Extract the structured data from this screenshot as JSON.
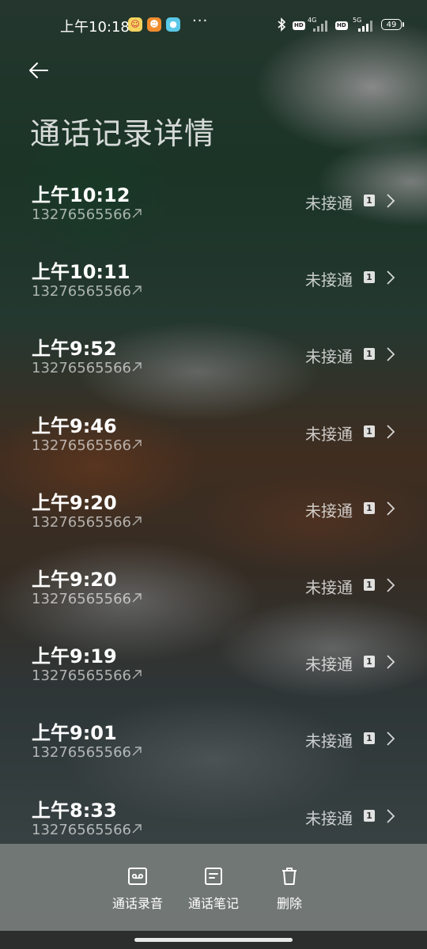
{
  "status_bar": {
    "time": "上午10:18",
    "notification_icons": [
      "app-notification-icon-1",
      "app-notification-icon-2",
      "app-notification-icon-3"
    ],
    "more": "···",
    "network_1": "4G",
    "network_2": "5G",
    "hd_label": "HD",
    "battery": "49"
  },
  "header": {
    "title": "通话记录详情"
  },
  "calls": [
    {
      "time": "上午10:12",
      "number": "13276565566",
      "status": "未接通",
      "sim": "1"
    },
    {
      "time": "上午10:11",
      "number": "13276565566",
      "status": "未接通",
      "sim": "1"
    },
    {
      "time": "上午9:52",
      "number": "13276565566",
      "status": "未接通",
      "sim": "1"
    },
    {
      "time": "上午9:46",
      "number": "13276565566",
      "status": "未接通",
      "sim": "1"
    },
    {
      "time": "上午9:20",
      "number": "13276565566",
      "status": "未接通",
      "sim": "1"
    },
    {
      "time": "上午9:20",
      "number": "13276565566",
      "status": "未接通",
      "sim": "1"
    },
    {
      "time": "上午9:19",
      "number": "13276565566",
      "status": "未接通",
      "sim": "1"
    },
    {
      "time": "上午9:01",
      "number": "13276565566",
      "status": "未接通",
      "sim": "1"
    },
    {
      "time": "上午8:33",
      "number": "13276565566",
      "status": "未接通",
      "sim": "1"
    }
  ],
  "toolbar": {
    "recordings_label": "通话录音",
    "notes_label": "通话笔记",
    "delete_label": "删除"
  },
  "colors": {
    "toolbar_bg": "#767c7a",
    "text_primary": "#ffffff"
  }
}
